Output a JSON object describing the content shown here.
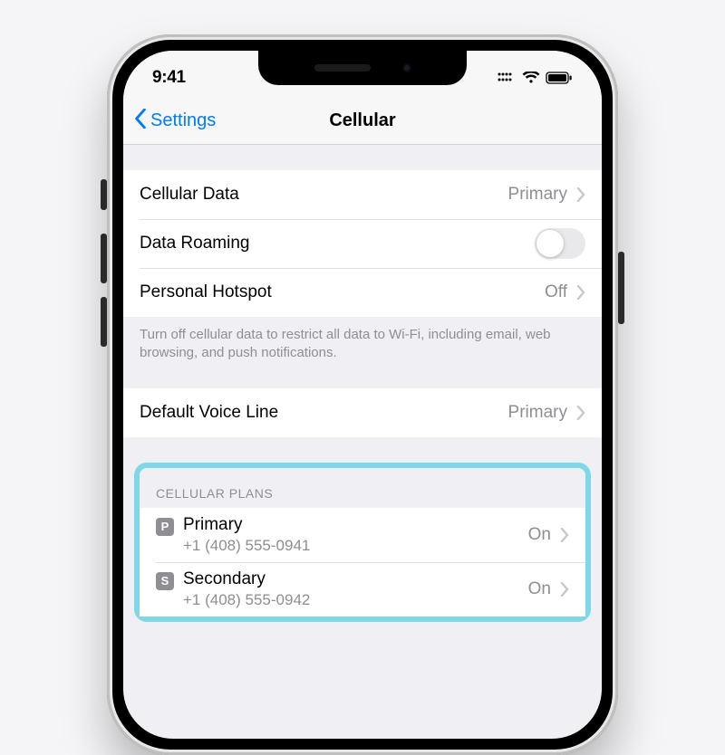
{
  "status": {
    "time": "9:41"
  },
  "nav": {
    "back": "Settings",
    "title": "Cellular"
  },
  "cells": {
    "cellular_data": {
      "label": "Cellular Data",
      "value": "Primary"
    },
    "data_roaming": {
      "label": "Data Roaming"
    },
    "hotspot": {
      "label": "Personal Hotspot",
      "value": "Off"
    },
    "voice_line": {
      "label": "Default Voice Line",
      "value": "Primary"
    }
  },
  "note": "Turn off cellular data to restrict all data to Wi-Fi, including email, web browsing, and push notifications.",
  "plans": {
    "header": "CELLULAR PLANS",
    "items": [
      {
        "badge": "P",
        "name": "Primary",
        "number": "+1 (408) 555-0941",
        "status": "On"
      },
      {
        "badge": "S",
        "name": "Secondary",
        "number": "+1 (408) 555-0942",
        "status": "On"
      }
    ]
  }
}
